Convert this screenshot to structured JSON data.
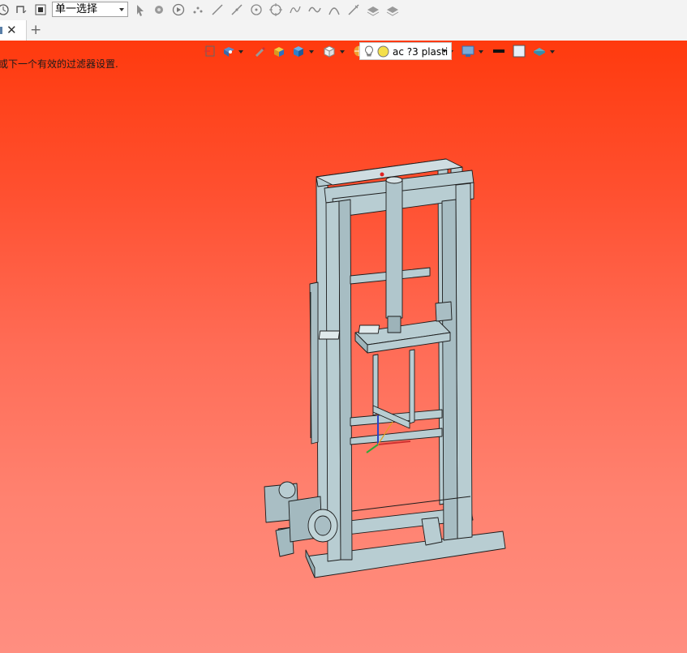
{
  "toolbar": {
    "selection_filter": "单一选择",
    "icons": [
      "rotate-icon",
      "snap-icon",
      "stop-icon",
      "select-arrow-icon",
      "select-multiple-icon",
      "play-icon",
      "point-icon",
      "line-icon",
      "line2-icon",
      "circle-point-icon",
      "circle-icon",
      "spline-icon",
      "curve-icon",
      "arc-icon",
      "edit-line-icon",
      "layers-icon",
      "layers2-icon"
    ]
  },
  "tabs": [
    {
      "label": "",
      "close_symbol": "✕"
    }
  ],
  "tab_add_symbol": "+",
  "viewport": {
    "status_message": "或下一个有效的过滤器设置.",
    "appearance_text": "ac ?3 plasti",
    "bg_top": "#ff3a0e",
    "bg_bottom": "#ff8e80",
    "model_color": "#b8cdd2",
    "edge_color": "#1c1c1c"
  },
  "view_toolbar_icons": [
    "fit-view-icon",
    "orient-icon",
    "pen-icon",
    "shaded-icon",
    "cube-icon",
    "wire-cube-icon",
    "section-icon",
    "zoom-icon",
    "red-box-icon",
    "frame-icon",
    "display-icon",
    "black-rect-icon",
    "white-square-icon",
    "layer-icon",
    "bulb-icon"
  ]
}
